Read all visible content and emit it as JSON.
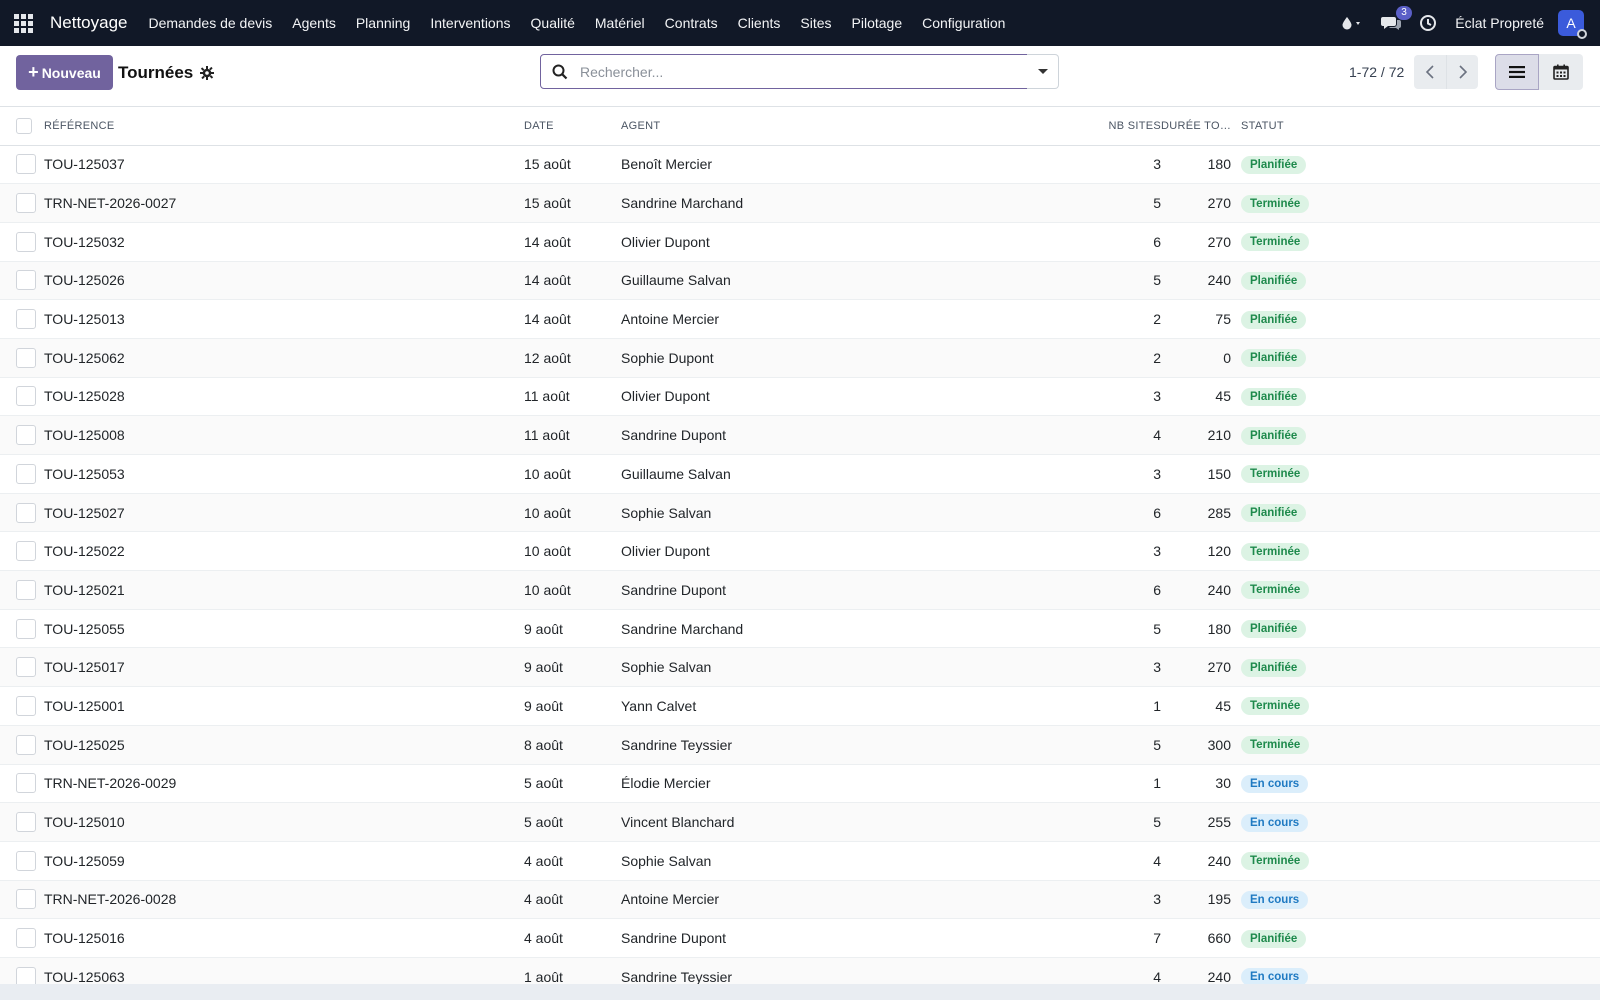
{
  "navbar": {
    "brand": "Nettoyage",
    "menu": [
      "Demandes de devis",
      "Agents",
      "Planning",
      "Interventions",
      "Qualité",
      "Matériel",
      "Contrats",
      "Clients",
      "Sites",
      "Pilotage",
      "Configuration"
    ],
    "messages_badge": "3",
    "company": "Éclat Propreté",
    "avatar_letter": "A"
  },
  "control": {
    "new_button": "Nouveau",
    "title": "Tournées",
    "search_placeholder": "Rechercher...",
    "pager": "1-72 / 72"
  },
  "table": {
    "headers": {
      "reference": "Référence",
      "date": "Date",
      "agent": "Agent",
      "nb_sites": "Nb sites",
      "duree": "Durée tot…",
      "statut": "Statut"
    },
    "rows": [
      {
        "ref": "TOU-125037",
        "date": "15 août",
        "agent": "Benoît Mercier",
        "nb": "3",
        "dur": "180",
        "status": "Planifiée",
        "kind": "planifiee"
      },
      {
        "ref": "TRN-NET-2026-0027",
        "date": "15 août",
        "agent": "Sandrine Marchand",
        "nb": "5",
        "dur": "270",
        "status": "Terminée",
        "kind": "terminee"
      },
      {
        "ref": "TOU-125032",
        "date": "14 août",
        "agent": "Olivier Dupont",
        "nb": "6",
        "dur": "270",
        "status": "Terminée",
        "kind": "terminee"
      },
      {
        "ref": "TOU-125026",
        "date": "14 août",
        "agent": "Guillaume Salvan",
        "nb": "5",
        "dur": "240",
        "status": "Planifiée",
        "kind": "planifiee"
      },
      {
        "ref": "TOU-125013",
        "date": "14 août",
        "agent": "Antoine Mercier",
        "nb": "2",
        "dur": "75",
        "status": "Planifiée",
        "kind": "planifiee"
      },
      {
        "ref": "TOU-125062",
        "date": "12 août",
        "agent": "Sophie Dupont",
        "nb": "2",
        "dur": "0",
        "status": "Planifiée",
        "kind": "planifiee"
      },
      {
        "ref": "TOU-125028",
        "date": "11 août",
        "agent": "Olivier Dupont",
        "nb": "3",
        "dur": "45",
        "status": "Planifiée",
        "kind": "planifiee"
      },
      {
        "ref": "TOU-125008",
        "date": "11 août",
        "agent": "Sandrine Dupont",
        "nb": "4",
        "dur": "210",
        "status": "Planifiée",
        "kind": "planifiee"
      },
      {
        "ref": "TOU-125053",
        "date": "10 août",
        "agent": "Guillaume Salvan",
        "nb": "3",
        "dur": "150",
        "status": "Terminée",
        "kind": "terminee"
      },
      {
        "ref": "TOU-125027",
        "date": "10 août",
        "agent": "Sophie Salvan",
        "nb": "6",
        "dur": "285",
        "status": "Planifiée",
        "kind": "planifiee"
      },
      {
        "ref": "TOU-125022",
        "date": "10 août",
        "agent": "Olivier Dupont",
        "nb": "3",
        "dur": "120",
        "status": "Terminée",
        "kind": "terminee"
      },
      {
        "ref": "TOU-125021",
        "date": "10 août",
        "agent": "Sandrine Dupont",
        "nb": "6",
        "dur": "240",
        "status": "Terminée",
        "kind": "terminee"
      },
      {
        "ref": "TOU-125055",
        "date": "9 août",
        "agent": "Sandrine Marchand",
        "nb": "5",
        "dur": "180",
        "status": "Planifiée",
        "kind": "planifiee"
      },
      {
        "ref": "TOU-125017",
        "date": "9 août",
        "agent": "Sophie Salvan",
        "nb": "3",
        "dur": "270",
        "status": "Planifiée",
        "kind": "planifiee"
      },
      {
        "ref": "TOU-125001",
        "date": "9 août",
        "agent": "Yann Calvet",
        "nb": "1",
        "dur": "45",
        "status": "Terminée",
        "kind": "terminee"
      },
      {
        "ref": "TOU-125025",
        "date": "8 août",
        "agent": "Sandrine Teyssier",
        "nb": "5",
        "dur": "300",
        "status": "Terminée",
        "kind": "terminee"
      },
      {
        "ref": "TRN-NET-2026-0029",
        "date": "5 août",
        "agent": "Élodie Mercier",
        "nb": "1",
        "dur": "30",
        "status": "En cours",
        "kind": "encours"
      },
      {
        "ref": "TOU-125010",
        "date": "5 août",
        "agent": "Vincent Blanchard",
        "nb": "5",
        "dur": "255",
        "status": "En cours",
        "kind": "encours"
      },
      {
        "ref": "TOU-125059",
        "date": "4 août",
        "agent": "Sophie Salvan",
        "nb": "4",
        "dur": "240",
        "status": "Terminée",
        "kind": "terminee"
      },
      {
        "ref": "TRN-NET-2026-0028",
        "date": "4 août",
        "agent": "Antoine Mercier",
        "nb": "3",
        "dur": "195",
        "status": "En cours",
        "kind": "encours"
      },
      {
        "ref": "TOU-125016",
        "date": "4 août",
        "agent": "Sandrine Dupont",
        "nb": "7",
        "dur": "660",
        "status": "Planifiée",
        "kind": "planifiee"
      },
      {
        "ref": "TOU-125063",
        "date": "1 août",
        "agent": "Sandrine Teyssier",
        "nb": "4",
        "dur": "240",
        "status": "En cours",
        "kind": "encours"
      }
    ]
  },
  "colors": {
    "navbar_bg": "#111827",
    "primary": "#71639e",
    "status_green_bg": "#dcf3e4",
    "status_green_fg": "#1e8a4c",
    "status_blue_bg": "#dbeefb",
    "status_blue_fg": "#1f7ac2"
  },
  "icons": [
    "apps-grid-icon",
    "droplet-icon",
    "chat-icon",
    "clock-icon",
    "gear-icon",
    "search-icon",
    "chevron-left-icon",
    "chevron-right-icon",
    "list-view-icon",
    "calendar-view-icon"
  ]
}
